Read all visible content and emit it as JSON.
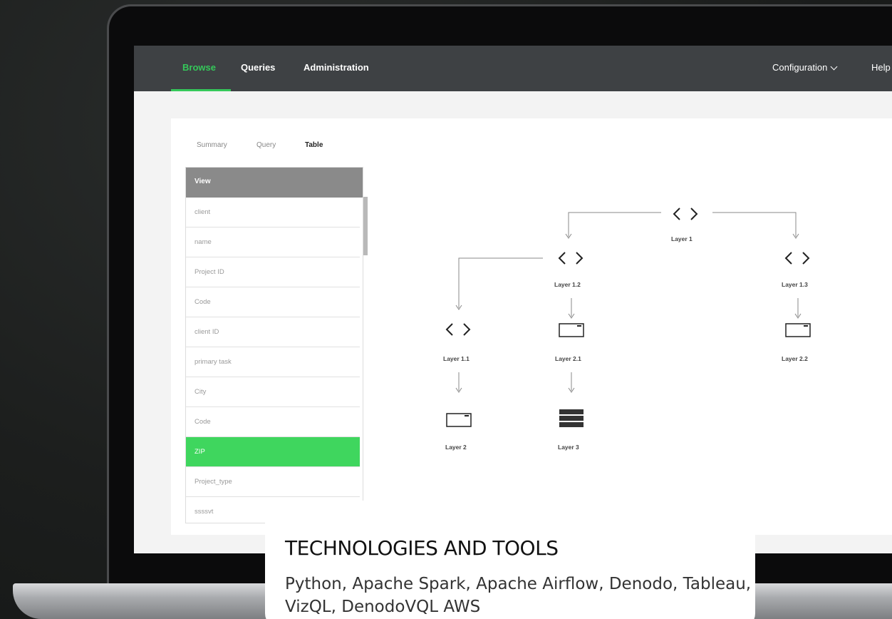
{
  "nav": {
    "browse": "Browse",
    "queries": "Queries",
    "administration": "Administration",
    "configuration": "Configuration",
    "help": "Help"
  },
  "subtabs": [
    "Summary",
    "Query",
    "Table"
  ],
  "list": {
    "header": "View",
    "rows": [
      "client",
      "name",
      "Project ID",
      "Code",
      "client ID",
      "primary task",
      "City",
      "Code",
      "ZIP",
      "Project_type",
      "ssssvt"
    ],
    "selected": "ZIP"
  },
  "diagram": {
    "nodes": [
      {
        "label": "Layer 1",
        "icon": "code-brackets-icon"
      },
      {
        "label": "Layer 1.2",
        "icon": "code-brackets-icon"
      },
      {
        "label": "Layer 1.3",
        "icon": "code-brackets-icon"
      },
      {
        "label": "Layer 1.1",
        "icon": "code-brackets-icon"
      },
      {
        "label": "Layer 2.1",
        "icon": "window-icon"
      },
      {
        "label": "Layer 2.2",
        "icon": "window-icon"
      },
      {
        "label": "Layer 2",
        "icon": "window-icon"
      },
      {
        "label": "Layer 3",
        "icon": "stack-icon"
      }
    ]
  },
  "card": {
    "title": "TECHNOLOGIES AND TOOLS",
    "text": "Python, Apache Spark, Apache Airflow, Denodo, Tableau, VizQL, DenodoVQL AWS"
  },
  "colors": {
    "accent": "#35c85a",
    "nav_bg": "#3e4144",
    "selected_row": "#3fd65e"
  }
}
